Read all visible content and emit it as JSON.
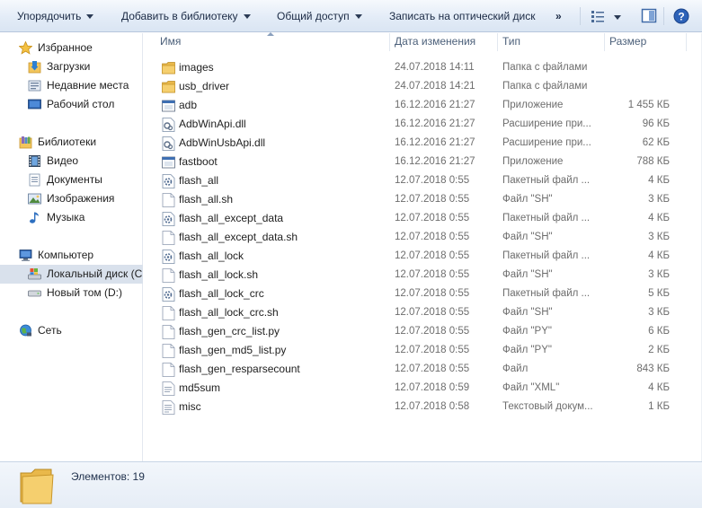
{
  "toolbar": {
    "organize": "Упорядочить",
    "add_library": "Добавить в библиотеку",
    "share": "Общий доступ",
    "burn": "Записать на оптический диск",
    "more": "»"
  },
  "nav": {
    "favorites": "Избранное",
    "downloads": "Загрузки",
    "recent": "Недавние места",
    "desktop": "Рабочий стол",
    "libraries": "Библиотеки",
    "video": "Видео",
    "documents": "Документы",
    "images": "Изображения",
    "music": "Музыка",
    "computer": "Компьютер",
    "local_disk": "Локальный диск (C",
    "new_volume": "Новый том (D:)",
    "network": "Сеть"
  },
  "columns": {
    "name": "Имя",
    "date": "Дата изменения",
    "type": "Тип",
    "size": "Размер"
  },
  "files": [
    {
      "name": "images",
      "date": "24.07.2018 14:11",
      "type": "Папка с файлами",
      "size": "",
      "icon": "folder-icon"
    },
    {
      "name": "usb_driver",
      "date": "24.07.2018 14:21",
      "type": "Папка с файлами",
      "size": "",
      "icon": "folder-icon"
    },
    {
      "name": "adb",
      "date": "16.12.2016 21:27",
      "type": "Приложение",
      "size": "1 455 КБ",
      "icon": "application-icon"
    },
    {
      "name": "AdbWinApi.dll",
      "date": "16.12.2016 21:27",
      "type": "Расширение при...",
      "size": "96 КБ",
      "icon": "dll-icon"
    },
    {
      "name": "AdbWinUsbApi.dll",
      "date": "16.12.2016 21:27",
      "type": "Расширение при...",
      "size": "62 КБ",
      "icon": "dll-icon"
    },
    {
      "name": "fastboot",
      "date": "16.12.2016 21:27",
      "type": "Приложение",
      "size": "788 КБ",
      "icon": "application-icon"
    },
    {
      "name": "flash_all",
      "date": "12.07.2018 0:55",
      "type": "Пакетный файл ...",
      "size": "4 КБ",
      "icon": "batch-file-icon"
    },
    {
      "name": "flash_all.sh",
      "date": "12.07.2018 0:55",
      "type": "Файл \"SH\"",
      "size": "3 КБ",
      "icon": "document-icon"
    },
    {
      "name": "flash_all_except_data",
      "date": "12.07.2018 0:55",
      "type": "Пакетный файл ...",
      "size": "4 КБ",
      "icon": "batch-file-icon"
    },
    {
      "name": "flash_all_except_data.sh",
      "date": "12.07.2018 0:55",
      "type": "Файл \"SH\"",
      "size": "3 КБ",
      "icon": "document-icon"
    },
    {
      "name": "flash_all_lock",
      "date": "12.07.2018 0:55",
      "type": "Пакетный файл ...",
      "size": "4 КБ",
      "icon": "batch-file-icon"
    },
    {
      "name": "flash_all_lock.sh",
      "date": "12.07.2018 0:55",
      "type": "Файл \"SH\"",
      "size": "3 КБ",
      "icon": "document-icon"
    },
    {
      "name": "flash_all_lock_crc",
      "date": "12.07.2018 0:55",
      "type": "Пакетный файл ...",
      "size": "5 КБ",
      "icon": "batch-file-icon"
    },
    {
      "name": "flash_all_lock_crc.sh",
      "date": "12.07.2018 0:55",
      "type": "Файл \"SH\"",
      "size": "3 КБ",
      "icon": "document-icon"
    },
    {
      "name": "flash_gen_crc_list.py",
      "date": "12.07.2018 0:55",
      "type": "Файл \"PY\"",
      "size": "6 КБ",
      "icon": "document-icon"
    },
    {
      "name": "flash_gen_md5_list.py",
      "date": "12.07.2018 0:55",
      "type": "Файл \"PY\"",
      "size": "2 КБ",
      "icon": "document-icon"
    },
    {
      "name": "flash_gen_resparsecount",
      "date": "12.07.2018 0:55",
      "type": "Файл",
      "size": "843 КБ",
      "icon": "document-icon"
    },
    {
      "name": "md5sum",
      "date": "12.07.2018 0:59",
      "type": "Файл \"XML\"",
      "size": "4 КБ",
      "icon": "xml-file-icon"
    },
    {
      "name": "misc",
      "date": "12.07.2018 0:58",
      "type": "Текстовый докум...",
      "size": "1 КБ",
      "icon": "text-file-icon"
    }
  ],
  "status": {
    "items": "Элементов: 19"
  },
  "colors": {
    "toolbar_bg": "#e3ecf7",
    "selected_nav": "#d9e1ec",
    "folder": "#f2c55c"
  }
}
